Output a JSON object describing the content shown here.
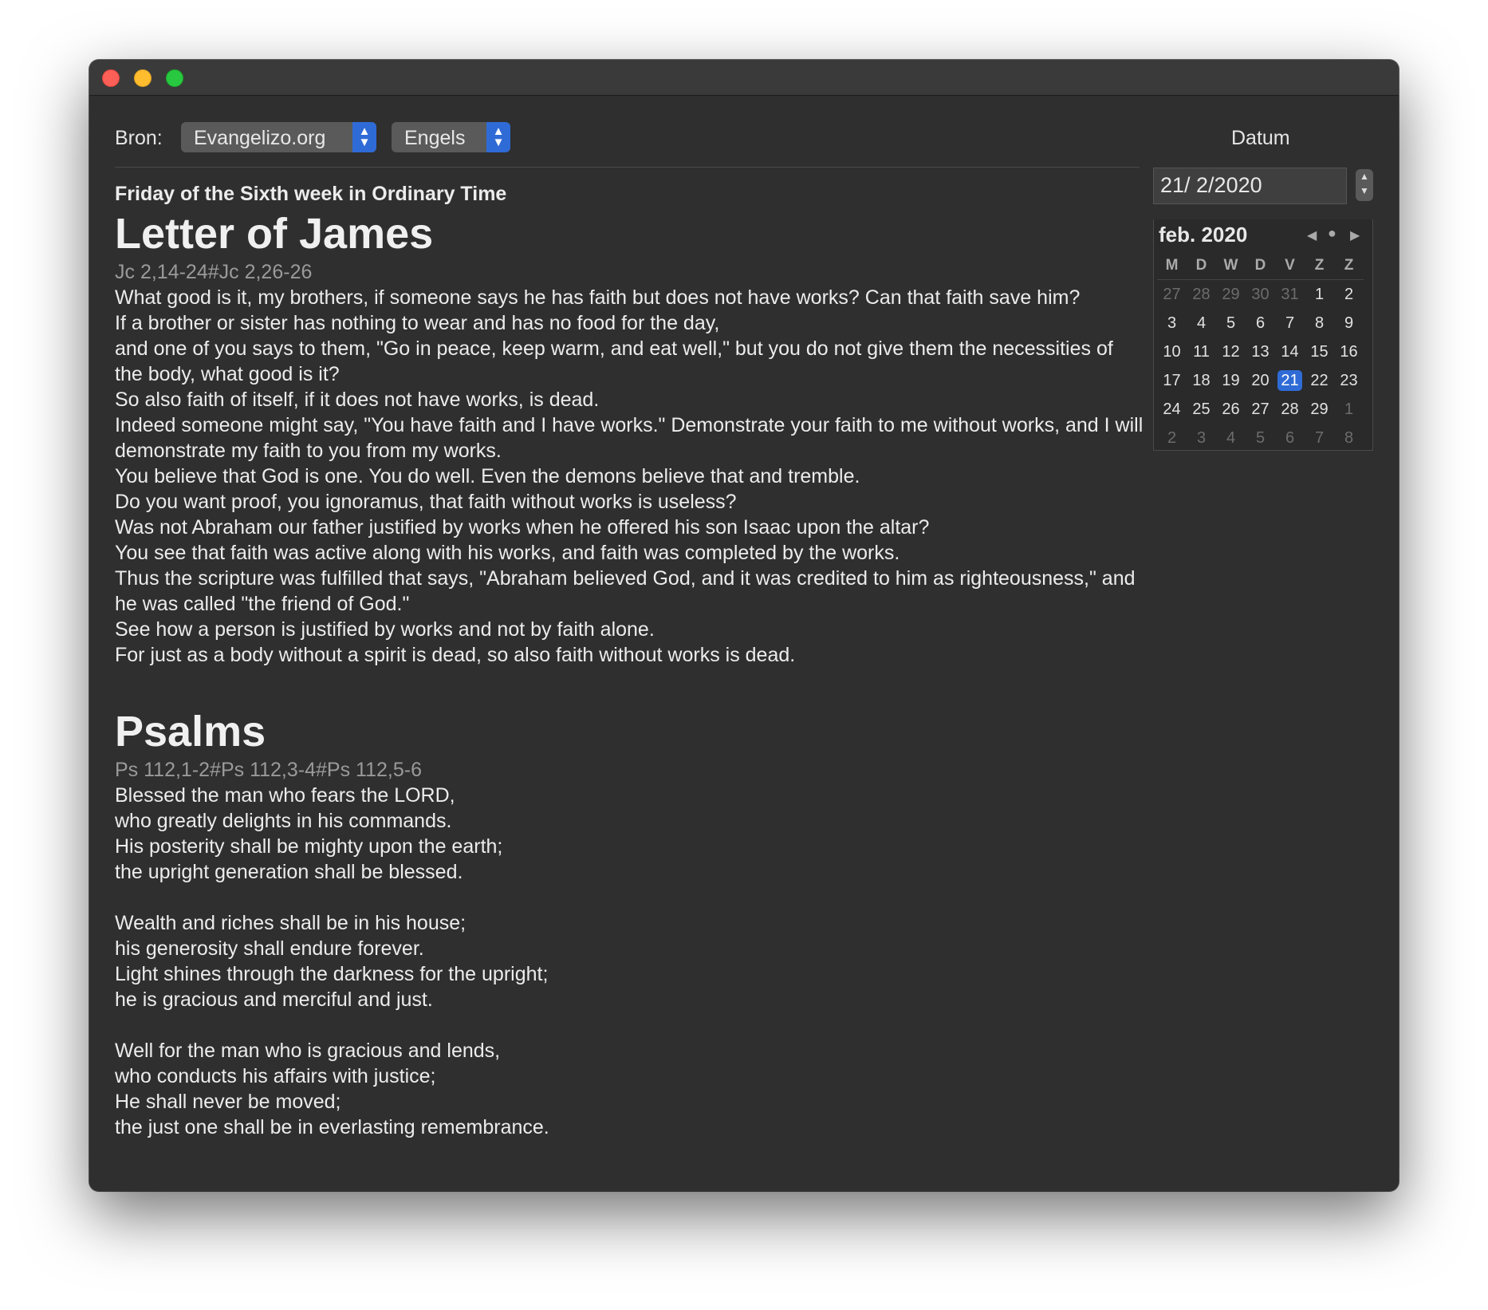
{
  "toolbar": {
    "source_label": "Bron:",
    "source_value": "Evangelizo.org",
    "language_value": "Engels",
    "stepper_glyph": "⌃⌄"
  },
  "reading": {
    "day_title": "Friday of the Sixth week in Ordinary Time",
    "sections": [
      {
        "book": "Letter of James",
        "reference": "Jc 2,14-24#Jc 2,26-26",
        "text": "What good is it, my brothers, if someone says he has faith but does not have works? Can that faith save him?\nIf a brother or sister has nothing to wear and has no food for the day,\nand one of you says to them, \"Go in peace, keep warm, and eat well,\" but you do not give them the necessities of the body, what good is it?\nSo also faith of itself, if it does not have works, is dead.\nIndeed someone might say, \"You have faith and I have works.\" Demonstrate your faith to me without works, and I will demonstrate my faith to you from my works.\nYou believe that God is one. You do well. Even the demons believe that and tremble.\nDo you want proof, you ignoramus, that faith without works is useless?\nWas not Abraham our father justified by works when he offered his son Isaac upon the altar?\nYou see that faith was active along with his works, and faith was completed by the works.\nThus the scripture was fulfilled that says, \"Abraham believed God, and it was credited to him as righteousness,\" and he was called \"the friend of God.\"\nSee how a person is justified by works and not by faith alone.\nFor just as a body without a spirit is dead, so also faith without works is dead."
      },
      {
        "book": "Psalms",
        "reference": "Ps 112,1-2#Ps 112,3-4#Ps 112,5-6",
        "text": "Blessed the man who fears the LORD,\nwho greatly delights in his commands.\nHis posterity shall be mighty upon the earth;\nthe upright generation shall be blessed.\n\nWealth and riches shall be in his house;\nhis generosity shall endure forever.\nLight shines through the darkness for the upright;\nhe is gracious and merciful and just.\n\nWell for the man who is gracious and lends,\nwho conducts his affairs with justice;\nHe shall never be moved;\nthe just one shall be in everlasting remembrance."
      }
    ]
  },
  "datum": {
    "label": "Datum",
    "date_value": "21/ 2/2020",
    "calendar": {
      "month_label": "feb. 2020",
      "weekdays": [
        "M",
        "D",
        "W",
        "D",
        "V",
        "Z",
        "Z"
      ],
      "weeks": [
        [
          "27",
          "28",
          "29",
          "30",
          "31",
          "1",
          "2"
        ],
        [
          "3",
          "4",
          "5",
          "6",
          "7",
          "8",
          "9"
        ],
        [
          "10",
          "11",
          "12",
          "13",
          "14",
          "15",
          "16"
        ],
        [
          "17",
          "18",
          "19",
          "20",
          "21",
          "22",
          "23"
        ],
        [
          "24",
          "25",
          "26",
          "27",
          "28",
          "29",
          "1"
        ],
        [
          "2",
          "3",
          "4",
          "5",
          "6",
          "7",
          "8"
        ]
      ],
      "selected_day": "21",
      "nav_prev": "◀",
      "nav_today": "●",
      "nav_next": "▶"
    }
  },
  "colors": {
    "window_bg": "#2f2f2f",
    "accent": "#2f6bd6",
    "close": "#fe5f57",
    "minimize": "#febc2e",
    "zoom": "#28c840"
  }
}
